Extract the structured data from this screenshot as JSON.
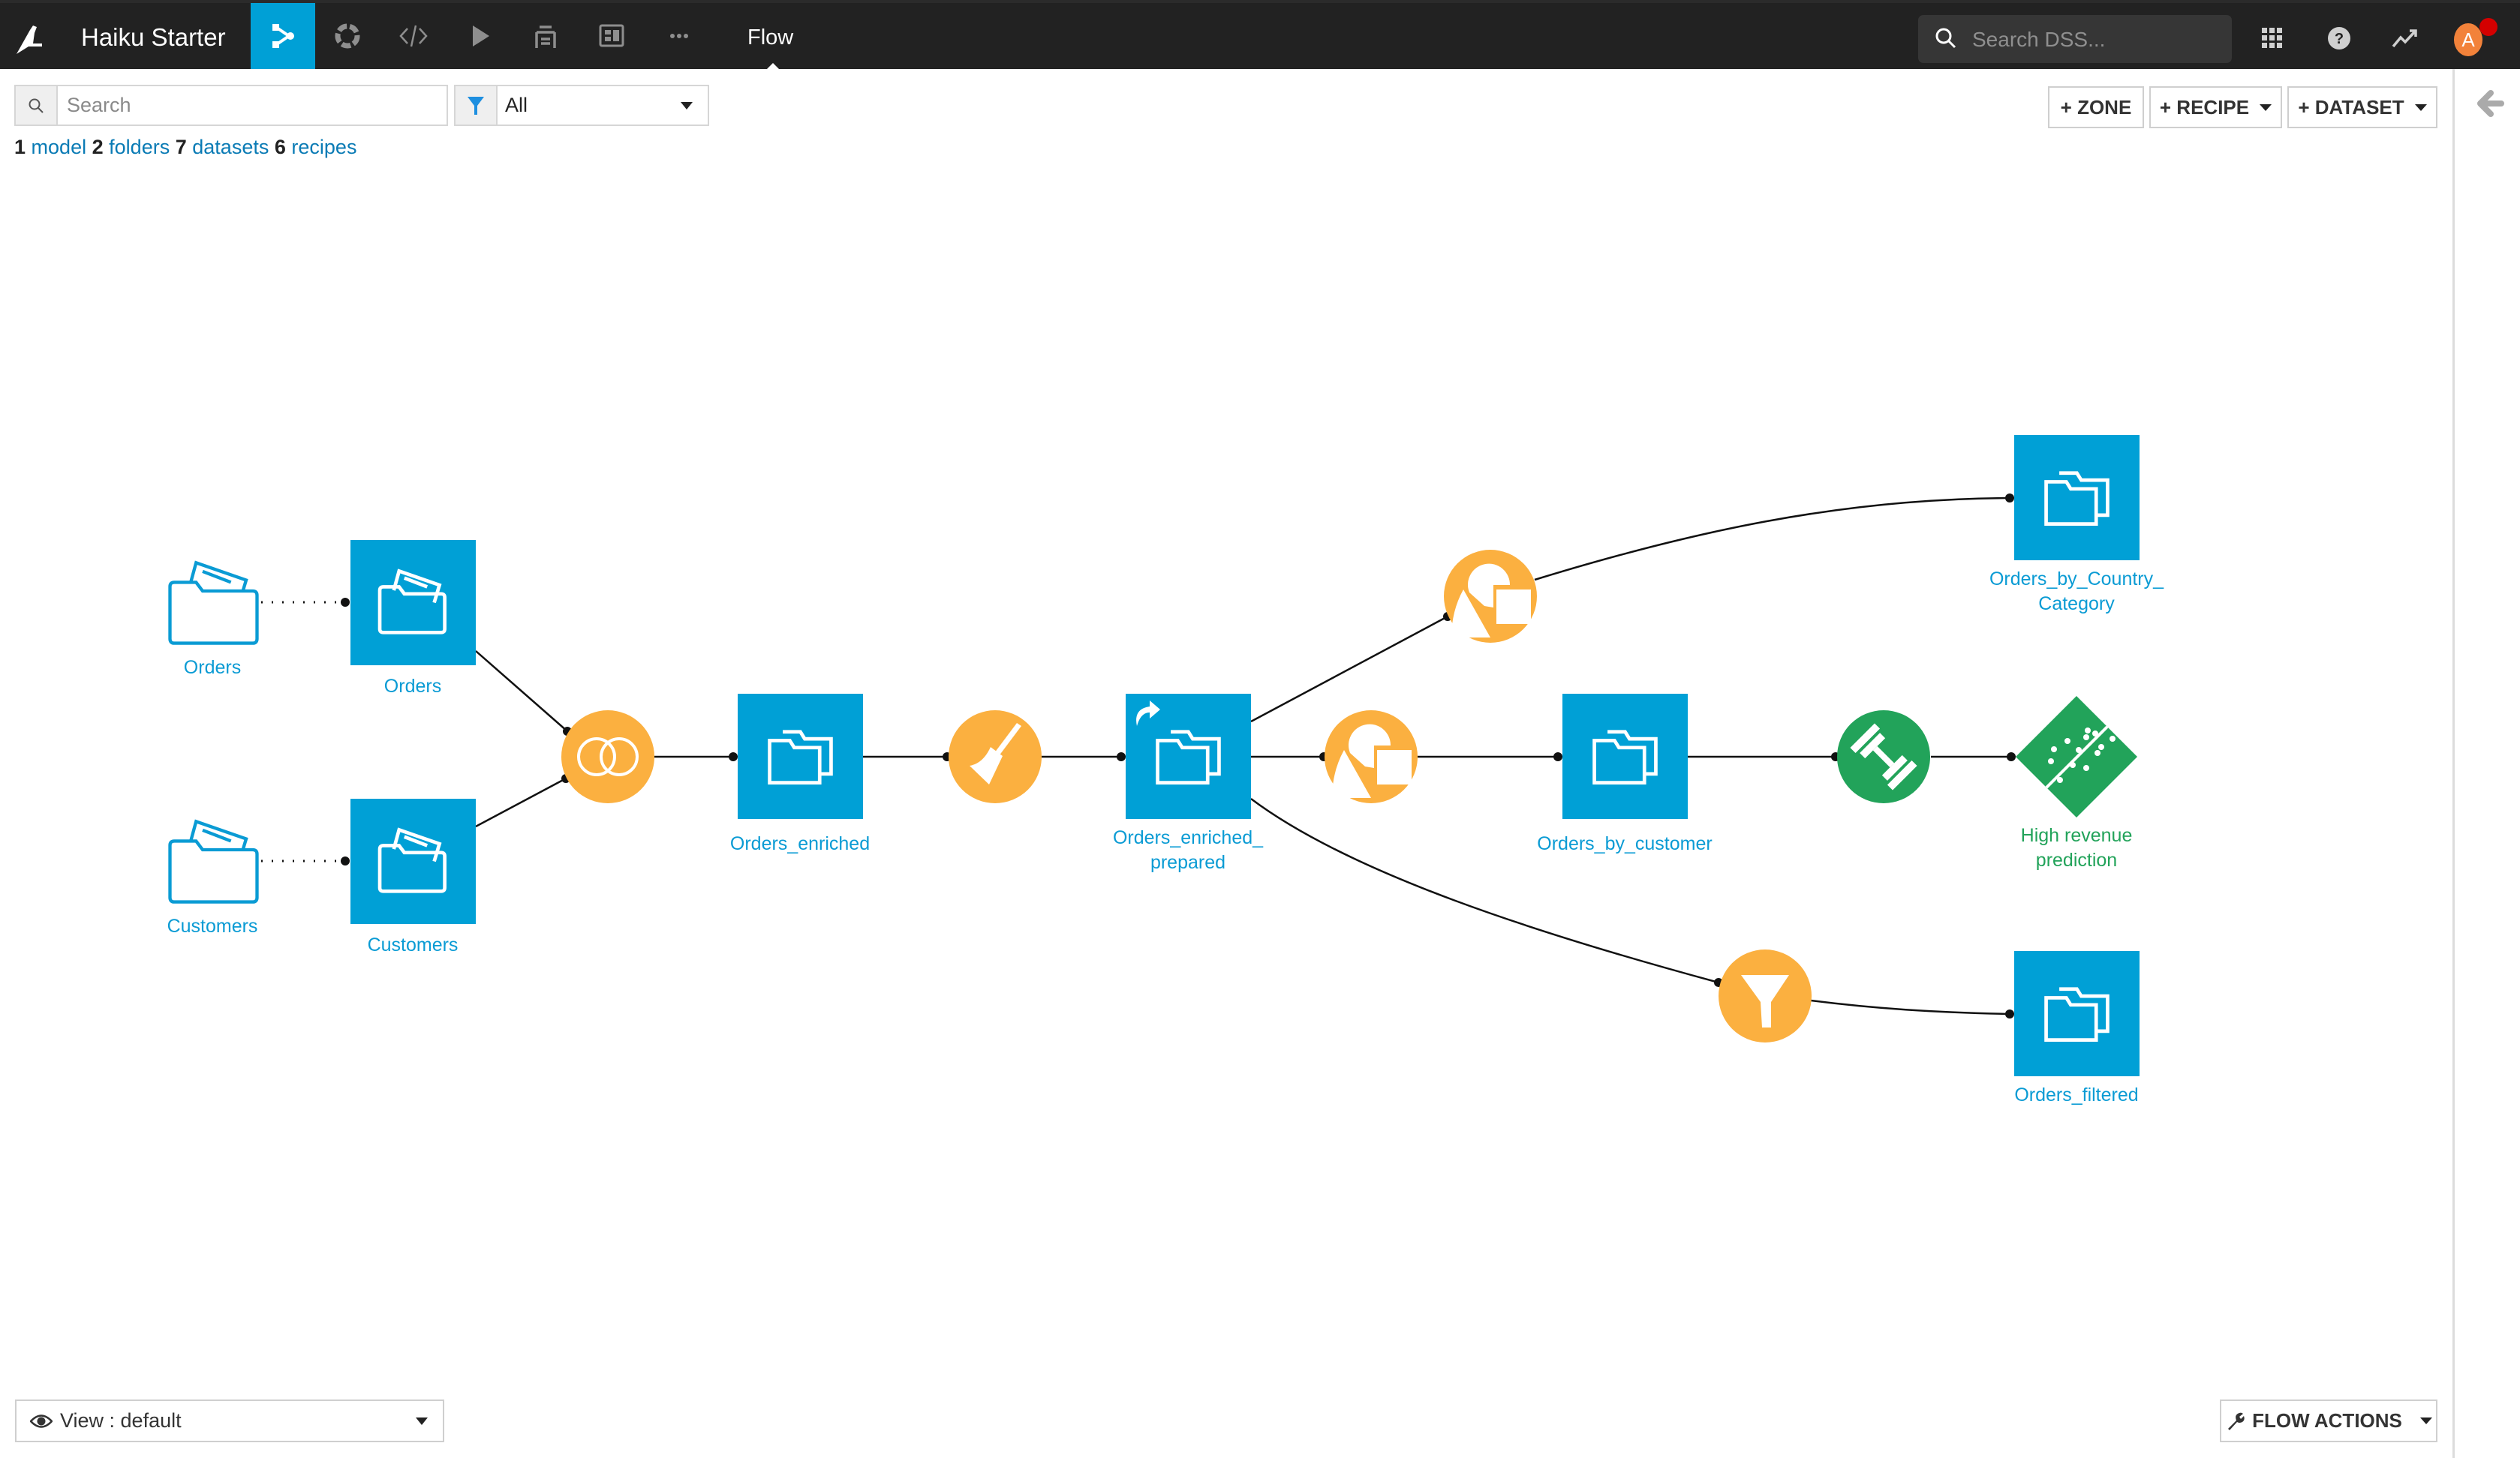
{
  "header": {
    "app_title": "Haiku Starter",
    "page_name": "Flow",
    "nav_items": [
      {
        "name": "flow",
        "icon": "flow-icon",
        "active": true
      },
      {
        "name": "lab",
        "icon": "lab-circle-icon",
        "active": false
      },
      {
        "name": "code",
        "icon": "code-icon",
        "active": false
      },
      {
        "name": "jobs",
        "icon": "play-icon",
        "active": false
      },
      {
        "name": "wiki",
        "icon": "stack-icon",
        "active": false
      },
      {
        "name": "dashboards",
        "icon": "dashboard-icon",
        "active": false
      },
      {
        "name": "more",
        "icon": "more-icon",
        "active": false
      }
    ],
    "global_search_placeholder": "Search DSS...",
    "avatar_initial": "A",
    "right_icons": [
      "apps-grid-icon",
      "help-icon",
      "activity-icon"
    ]
  },
  "toolbar": {
    "search_placeholder": "Search",
    "filter_value": "All",
    "zone_button": "+ ZONE",
    "recipe_button": "+ RECIPE",
    "dataset_button": "+ DATASET"
  },
  "summary": {
    "model_count": "1",
    "model_label": "model",
    "folder_count": "2",
    "folder_label": "folders",
    "dataset_count": "7",
    "dataset_label": "datasets",
    "recipe_count": "6",
    "recipe_label": "recipes"
  },
  "flow": {
    "colors": {
      "dataset": "#00a0d6",
      "recipe": "#fbb040",
      "ml": "#22a35a",
      "edge": "#111111"
    },
    "folders": [
      {
        "id": "folder_orders",
        "label": "Orders"
      },
      {
        "id": "folder_customers",
        "label": "Customers"
      }
    ],
    "datasets": [
      {
        "id": "ds_orders",
        "label": "Orders"
      },
      {
        "id": "ds_customers",
        "label": "Customers"
      },
      {
        "id": "ds_orders_enriched",
        "label": "Orders_enriched"
      },
      {
        "id": "ds_orders_enriched_prepared",
        "label_line1": "Orders_enriched_",
        "label_line2": "prepared"
      },
      {
        "id": "ds_orders_by_customer",
        "label": "Orders_by_customer"
      },
      {
        "id": "ds_orders_by_country_category",
        "label_line1": "Orders_by_Country_",
        "label_line2": "Category"
      },
      {
        "id": "ds_orders_filtered",
        "label": "Orders_filtered"
      }
    ],
    "recipes": [
      {
        "id": "rc_join",
        "type": "join"
      },
      {
        "id": "rc_prepare",
        "type": "prepare"
      },
      {
        "id": "rc_group_country",
        "type": "group"
      },
      {
        "id": "rc_group_customer",
        "type": "group"
      },
      {
        "id": "rc_train",
        "type": "train"
      },
      {
        "id": "rc_filter",
        "type": "filter"
      }
    ],
    "models": [
      {
        "id": "model_high_revenue",
        "label_line1": "High revenue",
        "label_line2": "prediction"
      }
    ]
  },
  "footer": {
    "view_label": "View : default",
    "flow_actions_label": "FLOW ACTIONS"
  }
}
